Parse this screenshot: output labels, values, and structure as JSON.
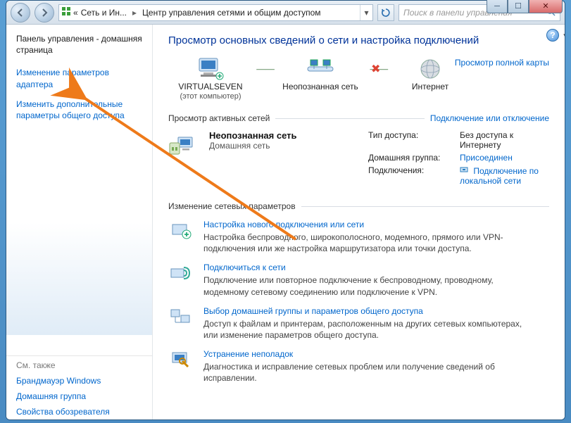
{
  "window": {
    "sys": {
      "min": "─",
      "max": "☐",
      "close": "✕"
    }
  },
  "addressbar": {
    "icon_label": "control-panel-icon",
    "crumb1": "Сеть и Ин...",
    "crumb2": "Центр управления сетями и общим доступом",
    "search_placeholder": "Поиск в панели управления"
  },
  "sidebar": {
    "home": "Панель управления - домашняя страница",
    "tasks": [
      "Изменение параметров адаптера",
      "Изменить дополнительные параметры общего доступа"
    ],
    "seealso_label": "См. также",
    "seealso": [
      "Брандмауэр Windows",
      "Домашняя группа",
      "Свойства обозревателя"
    ]
  },
  "main": {
    "title": "Просмотр основных сведений о сети и настройка подключений",
    "fullmap": "Просмотр полной карты",
    "nodes": {
      "n1": {
        "name": "VIRTUALSEVEN",
        "sub": "(этот компьютер)"
      },
      "n2": {
        "name": "Неопознанная сеть",
        "sub": ""
      },
      "n3": {
        "name": "Интернет",
        "sub": ""
      }
    },
    "active_header": "Просмотр активных сетей",
    "active_right_link": "Подключение или отключение",
    "activenet": {
      "name": "Неопознанная сеть",
      "type": "Домашняя сеть",
      "access_label": "Тип доступа:",
      "access_value": "Без доступа к Интернету",
      "homegroup_label": "Домашняя группа:",
      "homegroup_value": "Присоединен",
      "connections_label": "Подключения:",
      "connections_value": "Подключение по локальной сети"
    },
    "change_header": "Изменение сетевых параметров",
    "tasks": [
      {
        "title": "Настройка нового подключения или сети",
        "desc": "Настройка беспроводного, широкополосного, модемного, прямого или VPN-подключения или же настройка маршрутизатора или точки доступа."
      },
      {
        "title": "Подключиться к сети",
        "desc": "Подключение или повторное подключение к беспроводному, проводному, модемному сетевому соединению или подключение к VPN."
      },
      {
        "title": "Выбор домашней группы и параметров общего доступа",
        "desc": "Доступ к файлам и принтерам, расположенным на других сетевых компьютерах, или изменение параметров общего доступа."
      },
      {
        "title": "Устранение неполадок",
        "desc": "Диагностика и исправление сетевых проблем или получение сведений об исправлении."
      }
    ]
  }
}
